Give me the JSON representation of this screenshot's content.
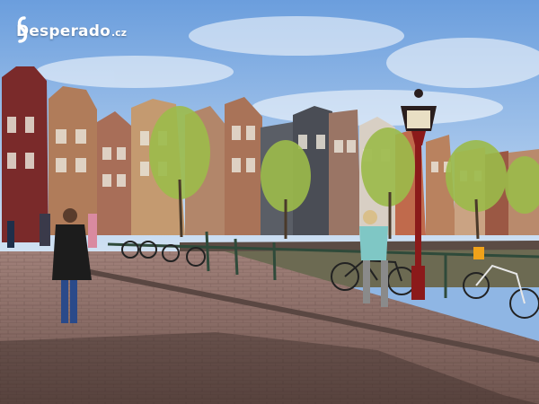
{
  "watermark": {
    "brand": "Desperado",
    "tld": ".cz",
    "icon": "desperado-logo-icon"
  },
  "colors": {
    "sky": "#8fb6e4",
    "brick_pavement": "#8a6b63",
    "canal_water": "#6c6a52",
    "lamp_post": "#8b1a1a",
    "tree_foliage": "#9cbb4a"
  }
}
